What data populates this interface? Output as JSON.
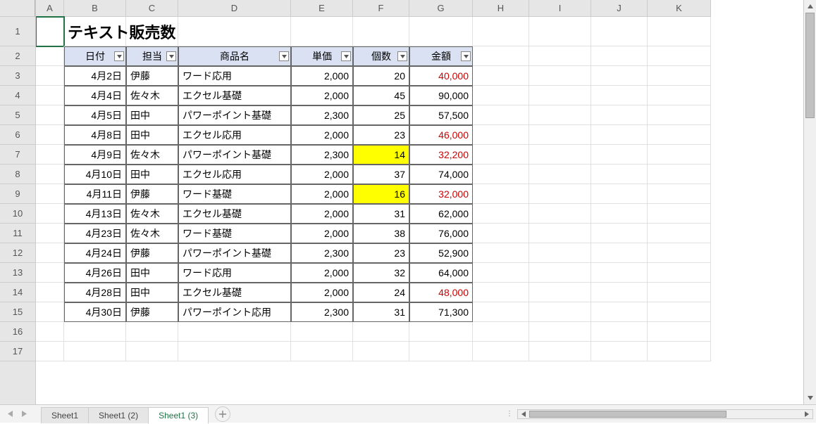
{
  "columns": [
    {
      "letter": "A",
      "w": 40
    },
    {
      "letter": "B",
      "w": 88
    },
    {
      "letter": "C",
      "w": 74
    },
    {
      "letter": "D",
      "w": 160
    },
    {
      "letter": "E",
      "w": 88
    },
    {
      "letter": "F",
      "w": 80
    },
    {
      "letter": "G",
      "w": 90
    },
    {
      "letter": "H",
      "w": 80
    },
    {
      "letter": "I",
      "w": 88
    },
    {
      "letter": "J",
      "w": 80
    },
    {
      "letter": "K",
      "w": 90
    }
  ],
  "row_heights": {
    "1": 42,
    "default": 28
  },
  "visible_rows": 17,
  "title": "テキスト販売数",
  "headers": [
    "日付",
    "担当",
    "商品名",
    "単価",
    "個数",
    "金額"
  ],
  "data": [
    {
      "date": "4月2日",
      "staff": "伊藤",
      "product": "ワード応用",
      "price": "2,000",
      "qty": "20",
      "amount": "40,000",
      "amt_red": true
    },
    {
      "date": "4月4日",
      "staff": "佐々木",
      "product": "エクセル基礎",
      "price": "2,000",
      "qty": "45",
      "amount": "90,000"
    },
    {
      "date": "4月5日",
      "staff": "田中",
      "product": "パワーポイント基礎",
      "price": "2,300",
      "qty": "25",
      "amount": "57,500"
    },
    {
      "date": "4月8日",
      "staff": "田中",
      "product": "エクセル応用",
      "price": "2,000",
      "qty": "23",
      "amount": "46,000",
      "amt_red": true
    },
    {
      "date": "4月9日",
      "staff": "佐々木",
      "product": "パワーポイント基礎",
      "price": "2,300",
      "qty": "14",
      "amount": "32,200",
      "amt_red": true,
      "qty_hl": true
    },
    {
      "date": "4月10日",
      "staff": "田中",
      "product": "エクセル応用",
      "price": "2,000",
      "qty": "37",
      "amount": "74,000"
    },
    {
      "date": "4月11日",
      "staff": "伊藤",
      "product": "ワード基礎",
      "price": "2,000",
      "qty": "16",
      "amount": "32,000",
      "amt_red": true,
      "qty_hl": true
    },
    {
      "date": "4月13日",
      "staff": "佐々木",
      "product": "エクセル基礎",
      "price": "2,000",
      "qty": "31",
      "amount": "62,000"
    },
    {
      "date": "4月23日",
      "staff": "佐々木",
      "product": "ワード基礎",
      "price": "2,000",
      "qty": "38",
      "amount": "76,000"
    },
    {
      "date": "4月24日",
      "staff": "伊藤",
      "product": "パワーポイント基礎",
      "price": "2,300",
      "qty": "23",
      "amount": "52,900"
    },
    {
      "date": "4月26日",
      "staff": "田中",
      "product": "ワード応用",
      "price": "2,000",
      "qty": "32",
      "amount": "64,000"
    },
    {
      "date": "4月28日",
      "staff": "田中",
      "product": "エクセル基礎",
      "price": "2,000",
      "qty": "24",
      "amount": "48,000",
      "amt_red": true
    },
    {
      "date": "4月30日",
      "staff": "伊藤",
      "product": "パワーポイント応用",
      "price": "2,300",
      "qty": "31",
      "amount": "71,300"
    }
  ],
  "selected_cell": "A1",
  "sheets": [
    {
      "name": "Sheet1",
      "active": false
    },
    {
      "name": "Sheet1 (2)",
      "active": false
    },
    {
      "name": "Sheet1 (3)",
      "active": true
    }
  ]
}
